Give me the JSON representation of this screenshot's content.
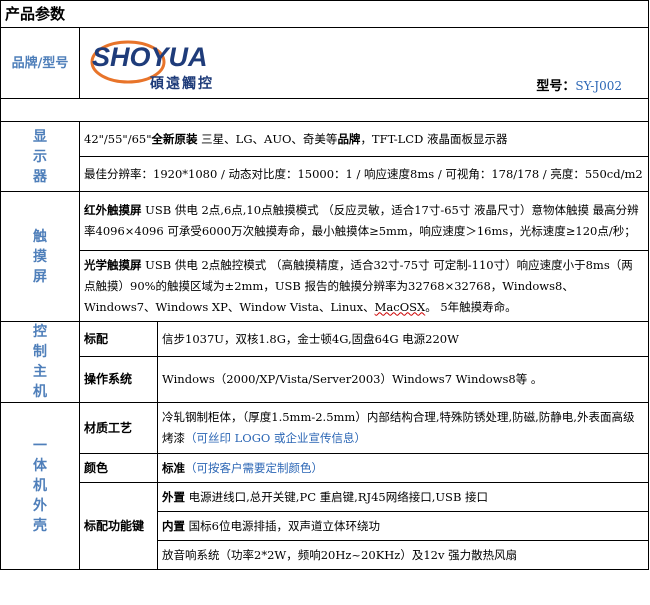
{
  "title": "产品参数",
  "brand": {
    "label": "品牌/型号",
    "logo_text": "SHOYUA",
    "logo_cn": "碩遠觸控",
    "model_label": "型号：",
    "model_value": "SY-J002"
  },
  "display": {
    "category": [
      "显",
      "示",
      "器"
    ],
    "row1_prefix": "42\"/55\"/65\"",
    "row1_bold1": "全新原装",
    "row1_mid": " 三星、LG、AUO、奇美等",
    "row1_bold2": "品牌",
    "row1_tail": "，TFT-LCD 液晶面板显示器",
    "row2": "最佳分辨率：1920*1080 / 动态对比度：15000：1 / 响应速度8ms / 可视角：178/178 / 亮度：550cd/m2"
  },
  "touch": {
    "category": [
      "触",
      "摸",
      "屏"
    ],
    "ir_label": "红外触摸屏",
    "ir_text": " USB 供电 2点,6点,10点触摸模式 （反应灵敏，适合17寸-65寸 液晶尺寸）意物体触摸 最高分辨率4096×4096 可承受6000万次触摸寿命，最小触摸体≥5mm，响应速度＞16ms，光标速度≥120点/秒；",
    "optical_label": "光学触摸屏",
    "optical_text1": " USB 供电 2点触控模式 （高触摸精度，适合32寸-75寸 可定制-110寸）响应速度小于8ms（两点触摸）90%的触摸区域为±2mm，USB 报告的触摸分辨率为32768×32768，Windows8、Windows7、Windows XP、Window Vista、Linux、",
    "optical_macos": "MacOSX",
    "optical_text2": "。 5年触摸寿命。"
  },
  "host": {
    "category": [
      "控",
      "制",
      "主",
      "机"
    ],
    "rows": [
      {
        "label": "标配",
        "value": "信步1037U，双核1.8G，金士顿4G,固盘64G 电源220W"
      },
      {
        "label": "操作系统",
        "value": "Windows（2000/XP/Vista/Server2003）Windows7 Windows8等 。"
      }
    ]
  },
  "cabinet": {
    "category": [
      "一",
      "体",
      "机",
      "外",
      "壳"
    ],
    "material_label": "材质工艺",
    "material_text": "冷轧钢制柜体，（厚度1.5mm-2.5mm）内部结构合理,特殊防锈处理,防磁,防静电,外表面高级烤漆",
    "material_note": "（可丝印 LOGO 或企业宣传信息）",
    "color_label": "颜色",
    "color_value": "标准",
    "color_note": "（可按客户需要定制颜色）",
    "std_label": "标配功能键",
    "std_rows": [
      {
        "bold": "外置",
        "text": " 电源进线口,总开关键,PC 重启键,RJ45网络接口,USB 接口"
      },
      {
        "bold": "内置",
        "text": " 国标6位电源排插，双声道立体环绕功"
      },
      {
        "bold": "",
        "text": "放音响系统（功率2*2W，频响20Hz~20KHz）及12v 强力散热风扇"
      }
    ]
  },
  "colors": {
    "accent_blue": "#4f7fba",
    "logo_navy": "#1f3c7a",
    "logo_orange": "#e8742a"
  }
}
